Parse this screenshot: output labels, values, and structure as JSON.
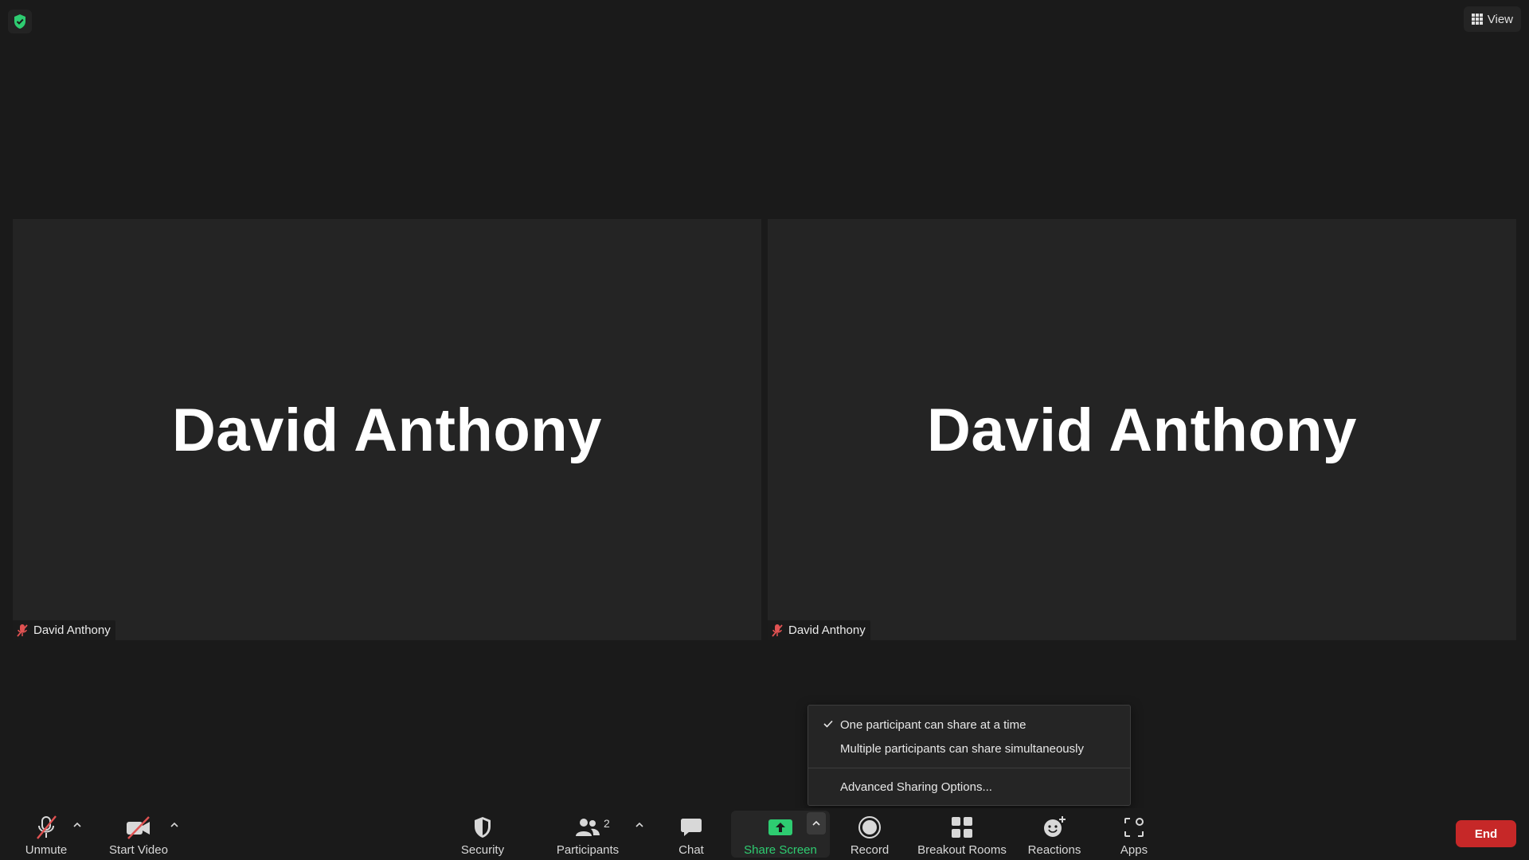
{
  "top": {
    "view_label": "View",
    "security_badge_color": "#2ecc71"
  },
  "tiles": [
    {
      "display_name": "David Anthony",
      "label_name": "David Anthony",
      "muted": true
    },
    {
      "display_name": "David Anthony",
      "label_name": "David Anthony",
      "muted": true
    }
  ],
  "share_menu": {
    "items": [
      {
        "label": "One participant can share at a time",
        "checked": true
      },
      {
        "label": "Multiple participants can share simultaneously",
        "checked": false
      },
      {
        "label": "Advanced Sharing Options...",
        "checked": false
      }
    ]
  },
  "toolbar": {
    "unmute": "Unmute",
    "start_video": "Start Video",
    "security": "Security",
    "participants": "Participants",
    "participants_count": "2",
    "chat": "Chat",
    "share_screen": "Share Screen",
    "record": "Record",
    "breakout_rooms": "Breakout Rooms",
    "reactions": "Reactions",
    "apps": "Apps",
    "end": "End"
  },
  "colors": {
    "accent_green": "#2ecc71",
    "end_red": "#c62828",
    "mute_red": "#e05252"
  }
}
